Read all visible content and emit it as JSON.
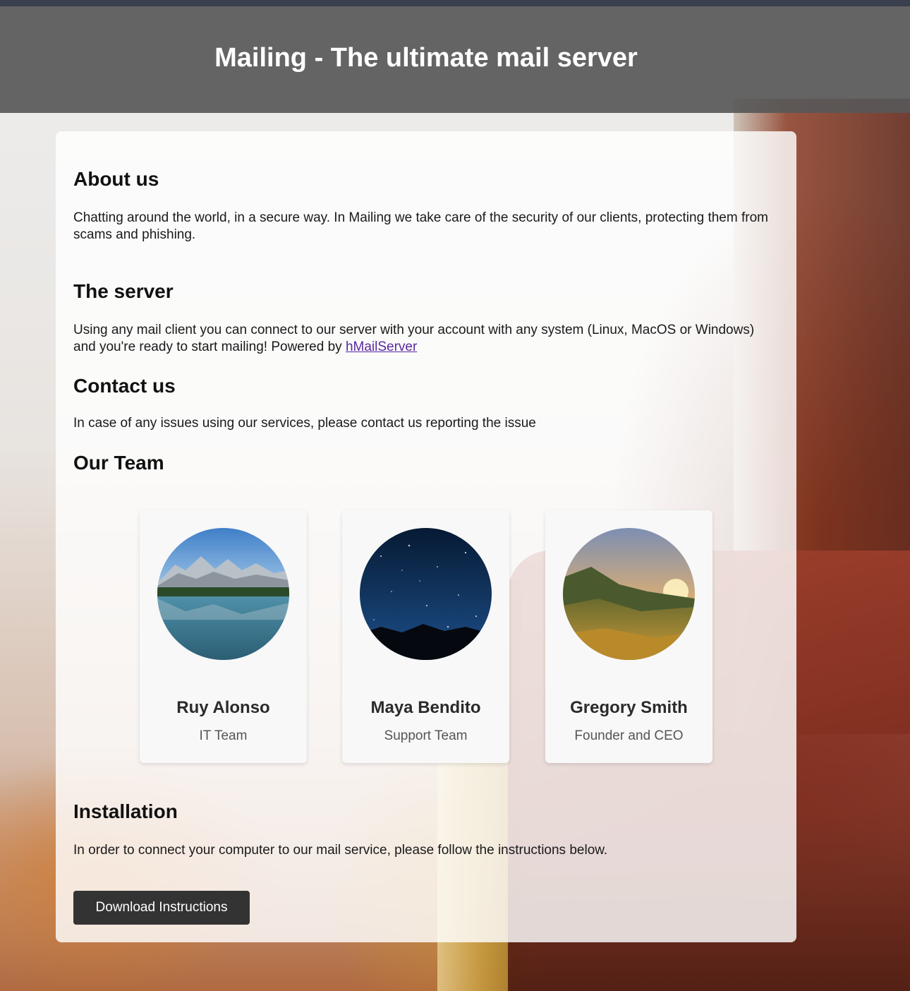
{
  "header": {
    "title": "Mailing - The ultimate mail server"
  },
  "sections": {
    "about": {
      "heading": "About us",
      "text": "Chatting around the world, in a secure way. In Mailing we take care of the security of our clients, protecting them from scams and phishing."
    },
    "server": {
      "heading": "The server",
      "text": "Using any mail client you can connect to our server with your account with any system (Linux, MacOS or Windows) and you're ready to start mailing! Powered by ",
      "link_text": "hMailServer"
    },
    "contact": {
      "heading": "Contact us",
      "text": "In case of any issues using our services, please contact us reporting the issue"
    },
    "team": {
      "heading": "Our Team",
      "members": [
        {
          "name": "Ruy Alonso",
          "role": "IT Team",
          "avatar": "mountain-lake-photo"
        },
        {
          "name": "Maya Bendito",
          "role": "Support Team",
          "avatar": "starry-night-photo"
        },
        {
          "name": "Gregory Smith",
          "role": "Founder and CEO",
          "avatar": "sunset-hills-photo"
        }
      ]
    },
    "installation": {
      "heading": "Installation",
      "text": "In order to connect your computer to our mail service, please follow the instructions below.",
      "button_label": "Download Instructions"
    }
  },
  "colors": {
    "header_bg": "#585858",
    "button_bg": "#333333",
    "link": "#5a2aa0"
  }
}
